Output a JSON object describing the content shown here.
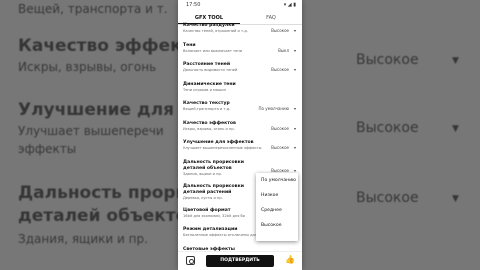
{
  "background": {
    "top_fragment": "Вещей, транспорта и т.",
    "items": [
      {
        "title": "Качество эффект",
        "sub": "Искры, взрывы, огонь",
        "value": "Высокое"
      },
      {
        "title": "Улучшение для э",
        "sub": "Улучшает вышеперечи",
        "sub2": "эффекты",
        "value": "Высокое"
      },
      {
        "title": "Дальность прори",
        "title2": "деталей объектов",
        "sub": "Здания, ящики и пр.",
        "value": "Высокое"
      }
    ]
  },
  "status": {
    "time": "17:50",
    "icons": "▾ ◢ ▮"
  },
  "tabs": [
    {
      "label": "GFX TOOL"
    },
    {
      "label": "FAQ"
    }
  ],
  "settings": [
    {
      "title": "Качество раздулки",
      "sub": "Качество теней, отражений и т.д.",
      "value": "Высокое"
    },
    {
      "title": "Тени",
      "sub": "Включает или выключает тени",
      "value": "Выкл"
    },
    {
      "title": "Расстояние теней",
      "sub": "Дальность видимости теней",
      "value": "Высокое"
    },
    {
      "title": "Динамические тени",
      "sub": "Тени игроков и машин",
      "value": ""
    },
    {
      "title": "Качество текстур",
      "sub": "Вещей,транспорта и т.д.",
      "value": "По умолчанию"
    },
    {
      "title": "Качество эффектов",
      "sub": "Искры, взрывы, огонь и пр.",
      "value": "Высокое"
    },
    {
      "title": "Улучшение для эффектов",
      "sub": "Улучшает вышеперечисленные эффекты",
      "value": "Высокое"
    },
    {
      "title": "Дальность прорисовки деталей объектов",
      "sub": "Здания, ящики и пр.",
      "value": "Высокое"
    },
    {
      "title": "Дальность прорисовки деталей растений",
      "sub": "Деревья, кусты и пр.",
      "value": ""
    },
    {
      "title": "Цветовой формат",
      "sub": "16bit для экономии, 32bit для бо",
      "value": ""
    },
    {
      "title": "Режим детализации",
      "sub": "Бесполезные эффекты отключены для фпс",
      "value": ""
    },
    {
      "title": "Световые эффекты",
      "sub": "Незначительные эффекты от солнца",
      "value": "Выкл"
    }
  ],
  "dropdown": {
    "options": [
      "По умолчанию",
      "Низкое",
      "Среднее",
      "Высокое"
    ]
  },
  "bottom": {
    "confirm_label": "ПОДТВЕРДИТЬ",
    "like_icon": "👍"
  }
}
